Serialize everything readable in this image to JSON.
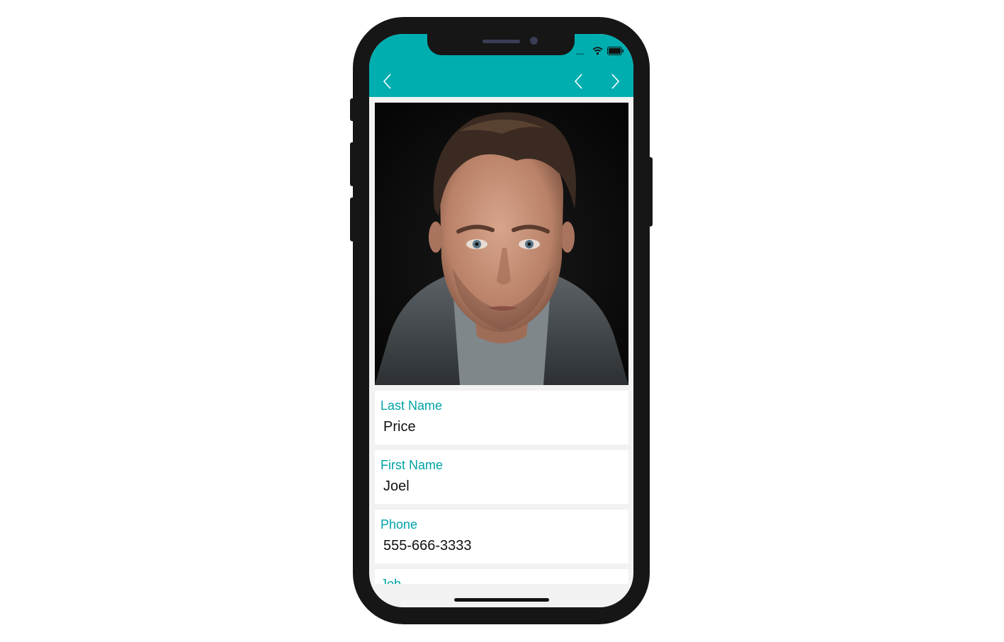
{
  "app": {
    "header_color": "#00aeb0",
    "accent_color": "#00a3a6"
  },
  "nav": {
    "back_icon": "chevron-left-icon",
    "previous_icon": "chevron-left-icon",
    "next_icon": "chevron-right-icon"
  },
  "status_bar": {
    "icons": [
      "signal-icon",
      "wifi-icon",
      "battery-icon"
    ]
  },
  "record": {
    "photo": "portrait-photo",
    "fields": [
      {
        "label": "Last Name",
        "value": "Price"
      },
      {
        "label": "First Name",
        "value": "Joel"
      },
      {
        "label": "Phone",
        "value": "555-666-3333"
      },
      {
        "label": "Job",
        "value": ""
      }
    ]
  }
}
